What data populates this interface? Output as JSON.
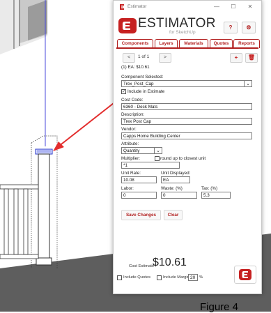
{
  "app": {
    "window_title": "Estimator",
    "logo_title": "ESTIMATOR",
    "logo_subtitle": "for SketchUp",
    "help_label": "?",
    "settings_label": "⚙"
  },
  "titlebar": {
    "minimize": "—",
    "maximize": "☐",
    "close": "✕"
  },
  "tabs": [
    {
      "label": "Components",
      "active": true
    },
    {
      "label": "Layers",
      "active": false
    },
    {
      "label": "Materials",
      "active": false
    },
    {
      "label": "Quotes",
      "active": false
    },
    {
      "label": "Reports",
      "active": false
    }
  ],
  "pager": {
    "prev": "<",
    "next": ">",
    "page_text": "1 of 1",
    "add": "+",
    "delete": "🗑"
  },
  "summary": "(1) EA: $10.61",
  "component": {
    "selected_label": "Component Selected:",
    "selected_value": "Trex_Post_Cap",
    "include_label": "Include in Estimate",
    "include_checked": true
  },
  "cost_code": {
    "label": "Cost Code:",
    "value": "6360 - Deck Mats"
  },
  "description": {
    "label": "Description:",
    "value": "Trex Post Cap"
  },
  "vendor": {
    "label": "Vendor:",
    "value": "Capps Home Building Center"
  },
  "attribute": {
    "label": "Attribute:",
    "value": "Quantity"
  },
  "multiplier": {
    "label": "Multiplier:",
    "value": "*1",
    "round_label": "round up to closest unit"
  },
  "unit_rate": {
    "label": "Unit Rate:",
    "value": "10.08"
  },
  "unit_displayed": {
    "label": "Unit Displayed:",
    "value": "EA"
  },
  "labor": {
    "label": "Labor:",
    "value": "0"
  },
  "waste": {
    "label": "Waste: (%)",
    "value": "0"
  },
  "tax": {
    "label": "Tax: (%)",
    "value": "5.3"
  },
  "actions": {
    "save": "Save Changes",
    "clear": "Clear"
  },
  "footer": {
    "cost_estimate_label": "Cost Estimate",
    "cost_estimate_value": "$10.61",
    "include_quotes_label": "Include Quotes",
    "include_margin_label": "Include Margin",
    "margin_value": "20",
    "percent_sign": "%"
  },
  "caption": "Figure 4",
  "colors": {
    "brand_red": "#b21f1f",
    "highlight": "#f7f35a",
    "arrow": "#e32d2d"
  }
}
